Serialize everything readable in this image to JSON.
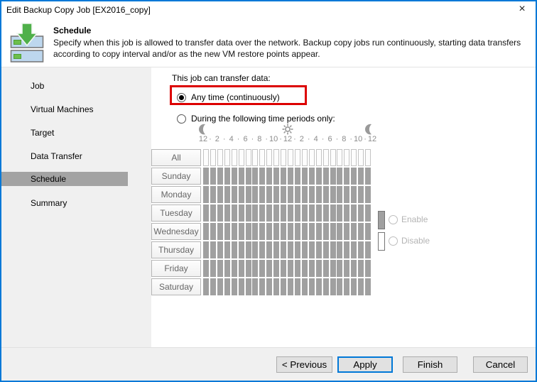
{
  "window": {
    "title": "Edit Backup Copy Job [EX2016_copy]",
    "close_glyph": "×"
  },
  "header": {
    "title": "Schedule",
    "description": "Specify when this job is allowed to transfer data over the network. Backup copy jobs run continuously, starting data transfers according to copy interval and/or as the new VM restore points appear."
  },
  "sidebar": {
    "items": [
      {
        "label": "Job",
        "selected": false
      },
      {
        "label": "Virtual Machines",
        "selected": false
      },
      {
        "label": "Target",
        "selected": false
      },
      {
        "label": "Data Transfer",
        "selected": false
      },
      {
        "label": "Schedule",
        "selected": true
      },
      {
        "label": "Summary",
        "selected": false
      }
    ]
  },
  "main": {
    "section_label": "This job can transfer data:",
    "option_any_time": {
      "label": "Any time (continuously)",
      "selected": true,
      "highlighted": true
    },
    "option_periods": {
      "label": "During the following time periods only:",
      "selected": false
    }
  },
  "schedule_grid": {
    "hour_labels": [
      "12",
      "2",
      "4",
      "6",
      "8",
      "10",
      "12",
      "2",
      "4",
      "6",
      "8",
      "10",
      "12"
    ],
    "dot_separator": "·",
    "columns": 24,
    "rows": [
      {
        "label": "All",
        "cells": "empty"
      },
      {
        "label": "Sunday",
        "cells": "enabled"
      },
      {
        "label": "Monday",
        "cells": "enabled"
      },
      {
        "label": "Tuesday",
        "cells": "enabled"
      },
      {
        "label": "Wednesday",
        "cells": "enabled"
      },
      {
        "label": "Thursday",
        "cells": "enabled"
      },
      {
        "label": "Friday",
        "cells": "enabled"
      },
      {
        "label": "Saturday",
        "cells": "enabled"
      }
    ],
    "legend": [
      {
        "label": "Enable",
        "swatch_color": "#a0a0a0"
      },
      {
        "label": "Disable",
        "swatch_color": "#ffffff"
      }
    ]
  },
  "footer": {
    "buttons": [
      {
        "label": "< Previous",
        "focused": false
      },
      {
        "label": "Apply",
        "focused": true
      },
      {
        "label": "Finish",
        "focused": false
      },
      {
        "label": "Cancel",
        "focused": false
      }
    ]
  },
  "colors": {
    "accent_blue": "#0078d7",
    "highlight_red": "#dc0000",
    "cell_enabled": "#a0a0a0",
    "sidebar_selected": "#a3a3a3"
  }
}
